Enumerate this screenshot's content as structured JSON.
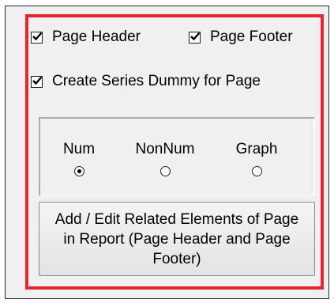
{
  "options": {
    "page_header_label": "Page Header",
    "page_header_checked": true,
    "page_footer_label": "Page Footer",
    "page_footer_checked": true,
    "series_dummy_label": "Create Series Dummy for Page",
    "series_dummy_checked": true
  },
  "mode_group": {
    "options": [
      {
        "label": "Num",
        "selected": true
      },
      {
        "label": "NonNum",
        "selected": false
      },
      {
        "label": "Graph",
        "selected": false
      }
    ]
  },
  "action_button": {
    "label": "Add / Edit Related Elements of Page in Report (Page Header and Page Footer)"
  },
  "colors": {
    "highlight_border": "#e8242c",
    "panel_background": "#f0f0f0"
  }
}
